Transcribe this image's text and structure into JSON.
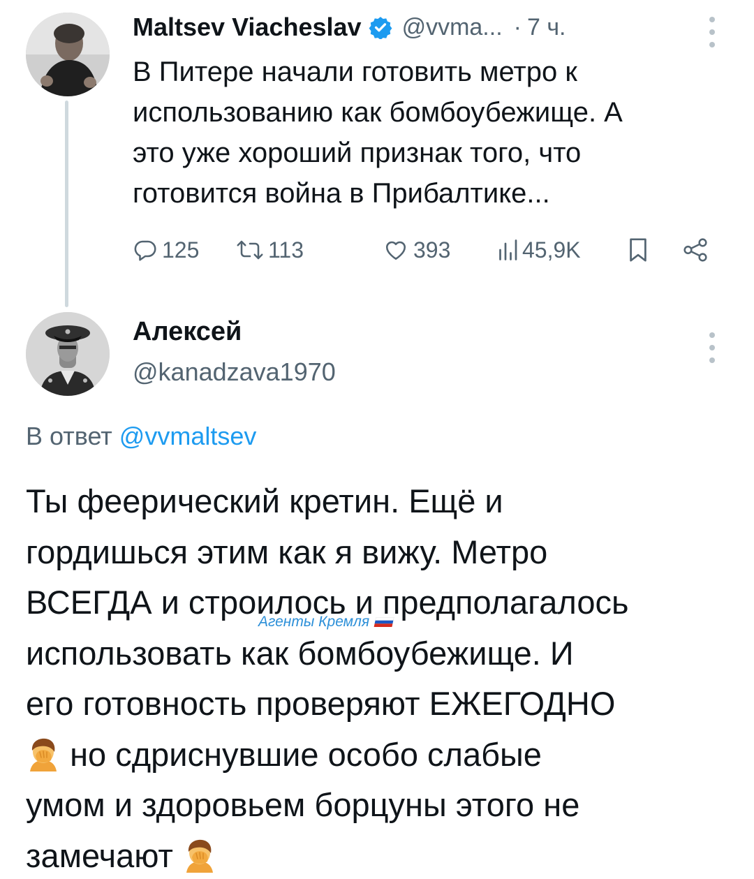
{
  "parent_tweet": {
    "author_name": "Maltsev Viacheslav",
    "handle": "@vvma...",
    "separator": "·",
    "time": "7 ч.",
    "verified_icon": "verified-badge-icon",
    "lines": [
      "В Питере начали готовить метро к",
      "использованию как бомбоубежище. А",
      "это уже хороший признак того, что",
      "готовится война в Прибалтике..."
    ],
    "stats": {
      "replies": "125",
      "retweets": "113",
      "likes": "393",
      "views": "45,9K"
    }
  },
  "reply_tweet": {
    "author_name": "Алексей",
    "handle": "@kanadzava1970",
    "replying_prefix": "В ответ",
    "replying_mention": "@vvmaltsev",
    "lines": [
      "Ты феерический кретин. Ещё и",
      "гордишься этим как я вижу. Метро",
      "ВСЕГДА и строилось и предполагалось",
      "использовать как бомбоубежище. И",
      "его готовность проверяют ЕЖЕГОДНО"
    ],
    "line6_text": "но сдриснувшие особо слабые",
    "line7": "умом и здоровьем борцуны этого не",
    "line8_text": "замечают",
    "emoji_name": "person-facepalming-icon"
  },
  "watermark": {
    "text": "Агенты Кремля",
    "flag_icon": "russian-flag-icon"
  },
  "colors": {
    "text": "#0f1419",
    "secondary": "#536471",
    "link": "#1d9bf0",
    "thread_line": "#cfd9de"
  }
}
